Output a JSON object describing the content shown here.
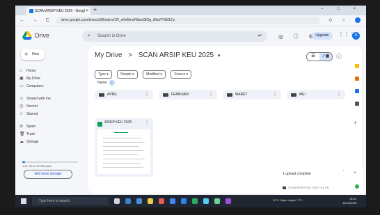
{
  "browser": {
    "tab_title": "SCAN ARSIP KEU 2025 - Googl",
    "tab_close": "×",
    "new_tab": "+",
    "window_controls": "– □ ×",
    "nav_buttons": "← → C ⇆",
    "url": "drive.google.com/drive/u/0/folders/1R_oHeMnoFt8wo9IGg_iMaVYNM1J ▸",
    "addr_icons": "⊙ ☆"
  },
  "header": {
    "app_name": "Drive",
    "search_placeholder": "Search in Drive",
    "icons": "◎ ⓘ ⚙",
    "upgrade_label": "Upgrade",
    "apps": "⋮⋮⋮",
    "avatar": "A"
  },
  "sidebar": {
    "new_label": "New",
    "items": [
      {
        "icon": "⌂",
        "label": "Home"
      },
      {
        "icon": "▣",
        "label": "My Drive"
      },
      {
        "icon": "▭",
        "label": "Computers"
      },
      {
        "icon": "☺",
        "label": "Shared with me"
      },
      {
        "icon": "◷",
        "label": "Recent"
      },
      {
        "icon": "☆",
        "label": "Starred"
      },
      {
        "icon": "⊘",
        "label": "Spam"
      },
      {
        "icon": "🗑",
        "label": "Trash"
      },
      {
        "icon": "☁",
        "label": "Storage"
      }
    ],
    "storage_used_fraction": 0.05,
    "storage_text": "1.67 GB of 15 GB used",
    "get_more_label": "Get more storage"
  },
  "main": {
    "breadcrumb_root": "My Drive",
    "breadcrumb_sep": ">",
    "breadcrumb_current": "SCAN ARSIP KEU 2025",
    "breadcrumb_chevron": "▾",
    "view_list": "☰",
    "view_grid": "✓▦",
    "info": "ⓘ",
    "filters": [
      "Type ▾",
      "People ▾",
      "Modified ▾",
      "Source ▾"
    ],
    "sort_label": "Name",
    "sort_arrow": "↑",
    "folders": [
      "APRIL",
      "FEBRUARI",
      "MARET",
      "MEI"
    ],
    "more": "⋮",
    "file_name": "ARSIP KEU 2025"
  },
  "upload": {
    "title": "1 upload complete",
    "controls": "ˇ ×",
    "file_text": "SCAN ARSIP KEU 2025   76.4 FB"
  },
  "taskbar": {
    "search_placeholder": "Type here to search",
    "weather": "28°C",
    "weather_text": "Hujan ringan",
    "tray_icons": "^ ⊡ ⌁",
    "time": "15:21",
    "date": "12/12/2025"
  },
  "colors": {
    "accent": "#1a73e8",
    "sheets_green": "#0f9d58",
    "upgrade_bg": "#d3e3fd"
  }
}
